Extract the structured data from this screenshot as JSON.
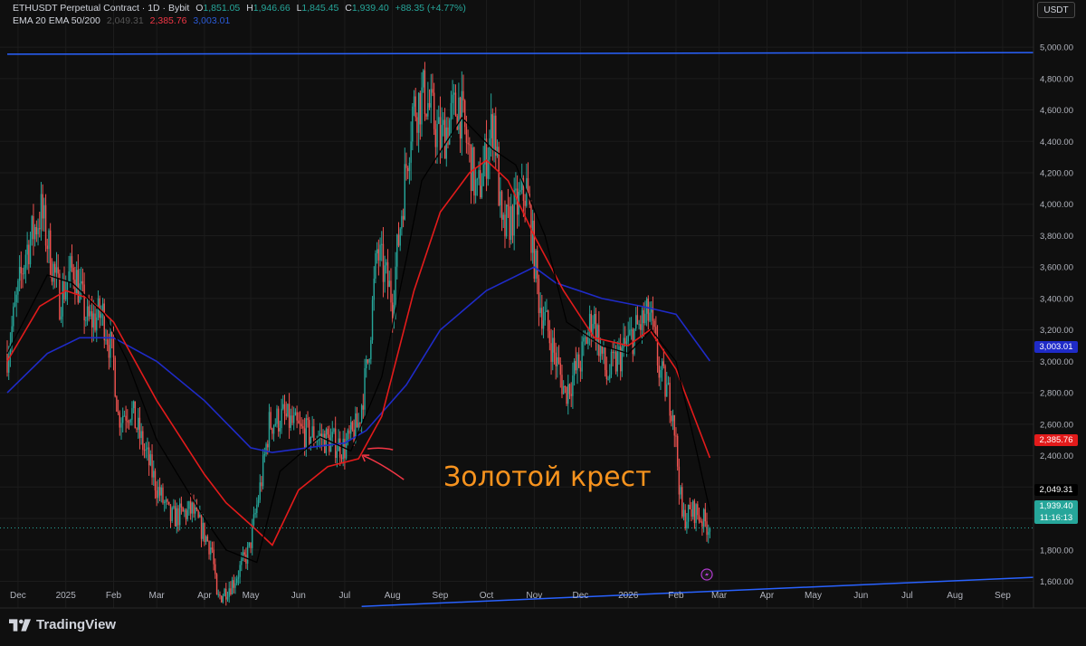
{
  "header": {
    "symbol": "ETHUSDT Perpetual Contract · 1D · Bybit",
    "open_label": "O",
    "open": "1,851.05",
    "high_label": "H",
    "high": "1,946.66",
    "low_label": "L",
    "low": "1,845.45",
    "close_label": "C",
    "close": "1,939.40",
    "change": "+88.35 (+4.77%)",
    "indicator_name": "EMA 20 EMA 50/200",
    "ema20_value": "2,049.31",
    "ema50_value": "2,385.76",
    "ema200_value": "3,003.01"
  },
  "currency": "USDT",
  "annotation": "Золотой крест",
  "brand": "TradingView",
  "price_tags": {
    "ema200": "3,003.01",
    "ema50": "2,385.76",
    "ema20": "2,049.31",
    "last_price": "1,939.40",
    "countdown": "11:16:13"
  },
  "colors": {
    "background": "#0f0f0f",
    "up": "#26a69a",
    "down": "#ef5350",
    "ema20": "#000000",
    "ema50": "#e31b1b",
    "ema200": "#1f2bc8",
    "trendline": "#2962ff",
    "annotation": "#f7931e"
  },
  "chart_data": {
    "type": "candlestick",
    "x_tick_labels": [
      "Dec",
      "2025",
      "Feb",
      "Mar",
      "Apr",
      "May",
      "Jun",
      "Jul",
      "Aug",
      "Sep",
      "Oct",
      "Nov",
      "Dec",
      "2026",
      "Feb",
      "Mar",
      "Apr",
      "May",
      "Jun",
      "Jul",
      "Aug",
      "Sep"
    ],
    "y_tick_labels": [
      "1,600.00",
      "1,800.00",
      "2,000.00",
      "2,200.00",
      "2,400.00",
      "2,600.00",
      "2,800.00",
      "3,000.00",
      "3,200.00",
      "3,400.00",
      "3,600.00",
      "3,800.00",
      "4,000.00",
      "4,200.00",
      "4,400.00",
      "4,600.00",
      "4,800.00",
      "5,000.00"
    ],
    "y_ticks": [
      1600,
      1800,
      2000,
      2200,
      2400,
      2600,
      2800,
      3000,
      3200,
      3400,
      3600,
      3800,
      4000,
      4200,
      4400,
      4600,
      4800,
      5000
    ],
    "ylim": [
      1430,
      5300
    ],
    "x_ticks": [
      "2024-12-01",
      "2025-01-01",
      "2025-02-01",
      "2025-03-01",
      "2025-04-01",
      "2025-05-01",
      "2025-06-01",
      "2025-07-01",
      "2025-08-01",
      "2025-09-01",
      "2025-10-01",
      "2025-11-01",
      "2025-12-01",
      "2026-01-01",
      "2026-02-01",
      "2026-03-01",
      "2026-04-01",
      "2026-05-01",
      "2026-06-01",
      "2026-07-01",
      "2026-08-01",
      "2026-09-01"
    ],
    "xlim": [
      "2024-11-24",
      "2026-09-21"
    ],
    "close_series": {
      "x": [
        "2024-11-24",
        "2024-12-06",
        "2024-12-16",
        "2024-12-28",
        "2025-01-06",
        "2025-01-15",
        "2025-01-25",
        "2025-02-01",
        "2025-02-04",
        "2025-02-12",
        "2025-02-24",
        "2025-03-01",
        "2025-03-10",
        "2025-03-24",
        "2025-04-06",
        "2025-04-09",
        "2025-04-20",
        "2025-04-30",
        "2025-05-08",
        "2025-05-13",
        "2025-05-22",
        "2025-06-03",
        "2025-06-20",
        "2025-07-01",
        "2025-07-10",
        "2025-07-16",
        "2025-07-22",
        "2025-08-01",
        "2025-08-10",
        "2025-08-14",
        "2025-08-22",
        "2025-09-01",
        "2025-09-13",
        "2025-09-25",
        "2025-10-06",
        "2025-10-11",
        "2025-10-27",
        "2025-11-04",
        "2025-11-21",
        "2025-12-01",
        "2025-12-09",
        "2025-12-18",
        "2026-01-06",
        "2026-01-15",
        "2026-01-21",
        "2026-01-30",
        "2026-02-05",
        "2026-02-13",
        "2026-02-23"
      ],
      "y": [
        3050,
        3700,
        3950,
        3400,
        3600,
        3250,
        3300,
        3000,
        2650,
        2700,
        2350,
        2200,
        2000,
        2050,
        1800,
        1480,
        1600,
        1800,
        2250,
        2600,
        2650,
        2550,
        2500,
        2450,
        2600,
        3000,
        3700,
        3400,
        4250,
        4600,
        4700,
        4400,
        4650,
        4050,
        4550,
        3800,
        4100,
        3400,
        2800,
        3000,
        3300,
        2900,
        3200,
        3300,
        2950,
        2700,
        2000,
        2050,
        1939
      ]
    },
    "ema20": {
      "x": [
        "2024-11-24",
        "2024-12-20",
        "2025-01-05",
        "2025-01-26",
        "2025-02-10",
        "2025-03-01",
        "2025-04-01",
        "2025-04-15",
        "2025-05-05",
        "2025-05-20",
        "2025-06-15",
        "2025-07-05",
        "2025-07-25",
        "2025-08-10",
        "2025-08-20",
        "2025-09-15",
        "2025-10-05",
        "2025-10-20",
        "2025-11-08",
        "2025-11-22",
        "2025-12-15",
        "2026-01-01",
        "2026-01-16",
        "2026-02-01",
        "2026-02-15",
        "2026-02-23"
      ],
      "y": [
        3050,
        3550,
        3500,
        3300,
        3000,
        2500,
        2000,
        1800,
        1720,
        2300,
        2520,
        2430,
        2900,
        3650,
        4150,
        4550,
        4350,
        4250,
        3800,
        3250,
        3100,
        3050,
        3200,
        3000,
        2400,
        2049
      ]
    },
    "ema50": {
      "x": [
        "2024-11-24",
        "2024-12-15",
        "2025-01-01",
        "2025-01-16",
        "2025-02-01",
        "2025-03-01",
        "2025-04-01",
        "2025-04-15",
        "2025-05-01",
        "2025-05-15",
        "2025-06-01",
        "2025-06-20",
        "2025-07-10",
        "2025-07-25",
        "2025-08-15",
        "2025-09-01",
        "2025-09-20",
        "2025-10-01",
        "2025-10-15",
        "2025-11-01",
        "2025-11-20",
        "2025-12-10",
        "2026-01-01",
        "2026-01-15",
        "2026-02-01",
        "2026-02-23"
      ],
      "y": [
        3000,
        3350,
        3450,
        3400,
        3250,
        2750,
        2280,
        2100,
        1960,
        1830,
        2180,
        2330,
        2380,
        2650,
        3450,
        3950,
        4200,
        4280,
        4150,
        3800,
        3450,
        3150,
        3100,
        3200,
        2950,
        2386
      ]
    },
    "ema200": {
      "x": [
        "2024-11-24",
        "2024-12-20",
        "2025-01-10",
        "2025-02-01",
        "2025-03-01",
        "2025-04-01",
        "2025-05-01",
        "2025-05-15",
        "2025-06-15",
        "2025-07-01",
        "2025-07-15",
        "2025-08-10",
        "2025-09-01",
        "2025-10-01",
        "2025-11-01",
        "2025-11-15",
        "2025-12-15",
        "2026-01-10",
        "2026-02-01",
        "2026-02-23"
      ],
      "y": [
        2800,
        3050,
        3150,
        3150,
        3000,
        2750,
        2450,
        2420,
        2460,
        2480,
        2560,
        2850,
        3200,
        3450,
        3600,
        3500,
        3400,
        3350,
        3300,
        3003
      ]
    },
    "trendlines": [
      {
        "x": [
          "2024-11-24",
          "2026-09-21"
        ],
        "y": [
          4955,
          4965
        ]
      },
      {
        "x": [
          "2025-07-12",
          "2026-09-21"
        ],
        "y": [
          1440,
          1625
        ]
      }
    ],
    "golden_cross": {
      "x": "2025-07-10",
      "y": 2420
    },
    "last_price": 1939.4
  }
}
